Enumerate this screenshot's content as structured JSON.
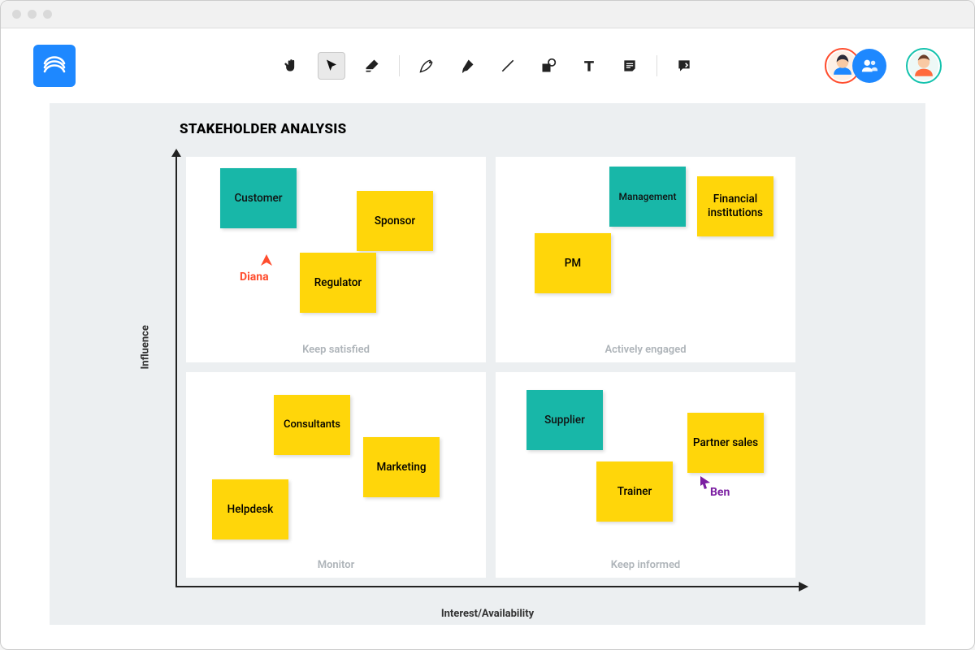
{
  "toolbar": {
    "hand": "hand-tool",
    "pointer": "pointer-tool",
    "eraser": "eraser-tool",
    "pen": "pen-tool",
    "marker": "marker-tool",
    "line": "line-tool",
    "shape": "shape-tool",
    "text": "text-tool",
    "sticky": "sticky-note-tool",
    "comment": "comment-tool"
  },
  "diagram": {
    "title": "STAKEHOLDER ANALYSIS",
    "y_axis": "Influence",
    "x_axis": "Interest/Availability",
    "quadrants": {
      "tl": "Keep satisfied",
      "tr": "Actively engaged",
      "bl": "Monitor",
      "br": "Keep informed"
    },
    "notes": {
      "customer": "Customer",
      "sponsor": "Sponsor",
      "regulator": "Regulator",
      "management": "Management",
      "financial": "Financial institutions",
      "pm": "PM",
      "consultants": "Consultants",
      "marketing": "Marketing",
      "helpdesk": "Helpdesk",
      "supplier": "Supplier",
      "partner": "Partner sales",
      "trainer": "Trainer"
    }
  },
  "collaborators": {
    "diana": "Diana",
    "ben": "Ben"
  }
}
